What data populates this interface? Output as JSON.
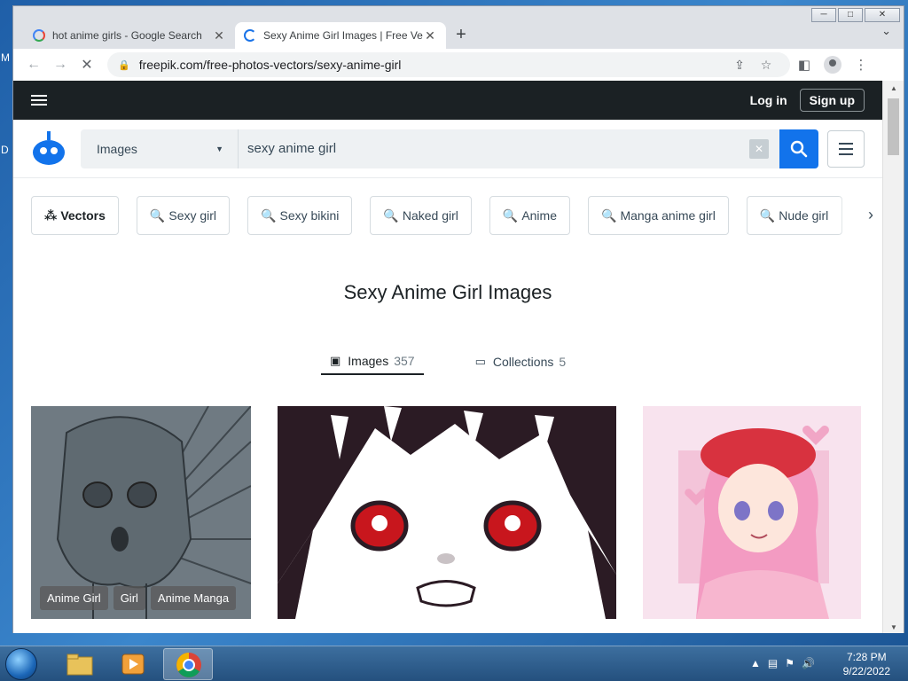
{
  "desktop": {
    "labels": [
      "M",
      "D"
    ]
  },
  "browser": {
    "tabs": [
      {
        "title": "hot anime girls - Google Search",
        "close": "✕"
      },
      {
        "title": "Sexy Anime Girl Images | Free Vectors",
        "close": "✕"
      }
    ],
    "new_tab": "+",
    "tab_menu": "⌄",
    "url": "freepik.com/free-photos-vectors/sexy-anime-girl",
    "window_controls": {
      "minimize": "─",
      "maximize": "□",
      "close": "✕"
    }
  },
  "site": {
    "login": "Log in",
    "signup": "Sign up",
    "search": {
      "type": "Images",
      "query": "sexy anime girl"
    },
    "chips": [
      {
        "label": "Vectors",
        "icon": "⁂"
      },
      {
        "label": "Sexy girl"
      },
      {
        "label": "Sexy bikini"
      },
      {
        "label": "Naked girl"
      },
      {
        "label": "Anime"
      },
      {
        "label": "Manga anime girl"
      },
      {
        "label": "Nude girl"
      }
    ],
    "page_title": "Sexy Anime Girl Images",
    "result_tabs": [
      {
        "label": "Images",
        "count": "357"
      },
      {
        "label": "Collections",
        "count": "5"
      }
    ],
    "card1_tags": [
      "Anime Girl",
      "Girl",
      "Anime Manga"
    ]
  },
  "taskbar": {
    "time": "7:28 PM",
    "date": "9/22/2022"
  },
  "colors": {
    "site_header": "#1b2124",
    "accent_blue": "#1273eb",
    "chrome_frame": "#dee1e6"
  }
}
